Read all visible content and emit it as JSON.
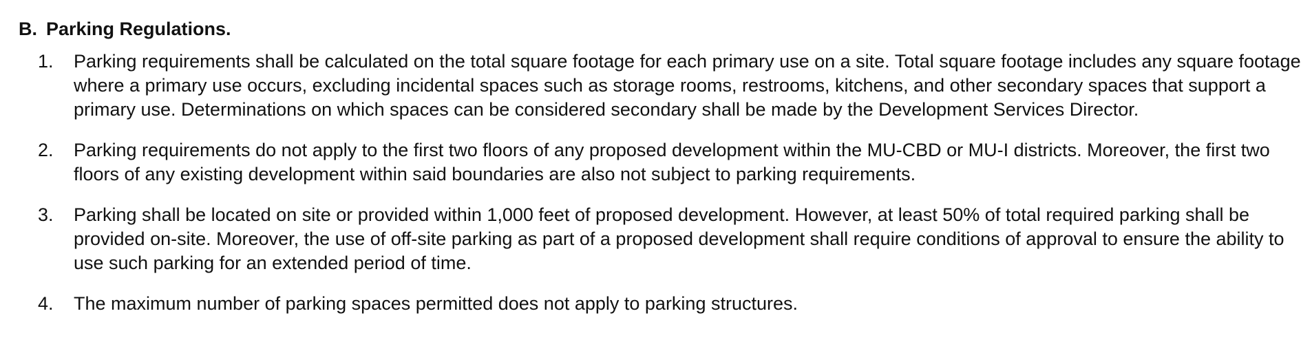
{
  "section": {
    "letter": "B.",
    "title": "Parking Regulations."
  },
  "items": [
    {
      "number": "1.",
      "text": "Parking requirements shall be calculated on the total square footage for each primary use on a site. Total square footage includes any square footage where a primary use occurs, excluding incidental spaces such as storage rooms, restrooms, kitchens, and other secondary spaces that support a primary use. Determinations on which spaces can be considered secondary shall be made by the Development Services Director."
    },
    {
      "number": "2.",
      "text": "Parking requirements do not apply to the first two floors of any proposed development within the MU-CBD or MU-I districts. Moreover, the first two floors of any existing development within said boundaries are also not subject to parking requirements."
    },
    {
      "number": "3.",
      "text": "Parking shall be located on site or provided within 1,000 feet of proposed development. However, at least 50% of total required parking shall be provided on-site. Moreover, the use of off-site parking as part of a proposed development shall require conditions of approval to ensure the ability to use such parking for an extended period of time."
    },
    {
      "number": "4.",
      "text": "The maximum number of parking spaces permitted does not apply to parking structures."
    }
  ]
}
